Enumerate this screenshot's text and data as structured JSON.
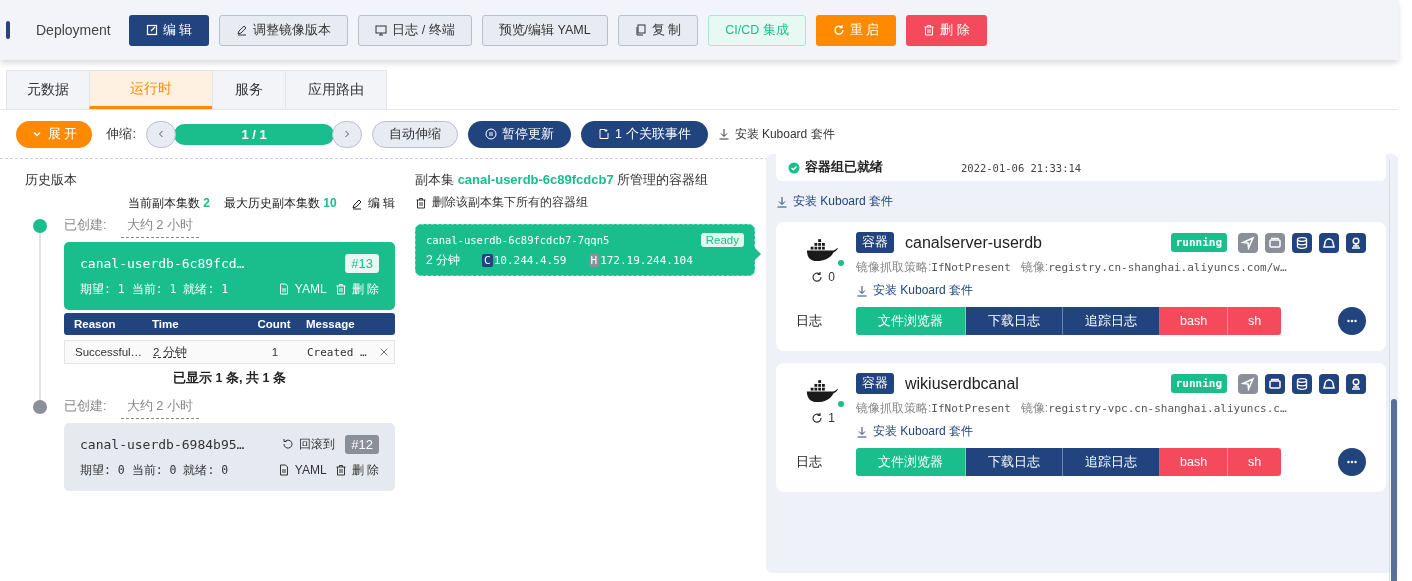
{
  "header": {
    "kind_label": "Deployment",
    "buttons": [
      {
        "label": "编 辑",
        "kind": "primary"
      },
      {
        "label": "调整镜像版本",
        "kind": "default"
      },
      {
        "label": "日志 / 终端",
        "kind": "default"
      },
      {
        "label": "预览/编辑 YAML",
        "kind": "default"
      },
      {
        "label": "复 制",
        "kind": "default"
      },
      {
        "label": "CI/CD 集成",
        "kind": "plain-success"
      },
      {
        "label": "重 启",
        "kind": "warning"
      },
      {
        "label": "删 除",
        "kind": "danger"
      }
    ]
  },
  "tabs": [
    {
      "label": "元数据",
      "selected": false
    },
    {
      "label": "运行时",
      "selected": true
    },
    {
      "label": "服务",
      "selected": false
    },
    {
      "label": "应用路由",
      "selected": false
    }
  ],
  "toolbar": {
    "expand": "展 开",
    "scale_label": "伸缩:",
    "replicas": "1 / 1",
    "level": 1,
    "auto_scale": "自动伸缩",
    "pause": "暂停更新",
    "events": "1 个关联事件",
    "install": "安装 Kuboard 套件"
  },
  "history": {
    "title": "历史版本",
    "current_label": "当前副本集数",
    "current_value": "2",
    "max_label": "最大历史副本集数",
    "max_value": "10",
    "edit": "编 辑",
    "revisions": [
      {
        "created_label": "已创建:",
        "created_time": "大约 2 小时",
        "name": "canal-userdb-6c89fcd…",
        "number": "#13",
        "current": true,
        "stats": "期望: 1 当前: 1 就绪: 1",
        "yaml": "YAML",
        "delete": "删 除",
        "events": {
          "columns": [
            "Reason",
            "Time",
            "Count",
            "Message"
          ],
          "rows": [
            [
              "Successful…",
              "2 分钟",
              "1",
              "Created …"
            ]
          ],
          "summary": "已显示 1 条, 共 1 条"
        }
      },
      {
        "created_label": "已创建:",
        "created_time": "大约 2 小时",
        "name": "canal-userdb-6984b95…",
        "number": "#12",
        "current": false,
        "rollback": "回滚到",
        "stats": "期望: 0 当前: 0 就绪: 0",
        "yaml": "YAML",
        "delete": "删 除"
      }
    ]
  },
  "replicaset": {
    "title_prefix": "副本集",
    "name": "canal-userdb-6c89fcdcb7",
    "title_suffix": "所管理的容器组",
    "delete_all": "删除该副本集下所有的容器组",
    "pods": [
      {
        "name": "canal-userdb-6c89fcdcb7-7qqn5",
        "status": "Ready",
        "age": "2 分钟",
        "container_tag": "C",
        "container_ip": "10.244.4.59",
        "host_tag": "H",
        "host_ip": "172.19.244.104"
      }
    ]
  },
  "pod_detail": {
    "ready_label": "容器组已就绪",
    "ready_time": "2022-01-06 21:33:14",
    "install": "安装 Kuboard 套件",
    "containers": [
      {
        "tag": "容器",
        "name": "canalserver-userdb",
        "status": "running",
        "pull_policy_label": "镜像抓取策略:",
        "pull_policy": "IfNotPresent",
        "image_label": "镜像:",
        "image": "registry.cn-shanghai.aliyuncs.com/w…",
        "restarts": "0",
        "install": "安装 Kuboard 套件",
        "log_label": "日志",
        "actions": [
          {
            "label": "文件浏览器",
            "kind": "success"
          },
          {
            "label": "下载日志",
            "kind": "primary"
          },
          {
            "label": "追踪日志",
            "kind": "primary"
          },
          {
            "label": "bash",
            "kind": "danger"
          },
          {
            "label": "sh",
            "kind": "danger"
          }
        ],
        "tools": [
          {
            "enabled": false
          },
          {
            "enabled": false
          },
          {
            "enabled": true
          },
          {
            "enabled": true
          },
          {
            "enabled": true
          }
        ]
      },
      {
        "tag": "容器",
        "name": "wikiuserdbcanal",
        "status": "running",
        "pull_policy_label": "镜像抓取策略:",
        "pull_policy": "IfNotPresent",
        "image_label": "镜像:",
        "image": "registry-vpc.cn-shanghai.aliyuncs.c…",
        "restarts": "1",
        "install": "安装 Kuboard 套件",
        "log_label": "日志",
        "actions": [
          {
            "label": "文件浏览器",
            "kind": "success"
          },
          {
            "label": "下载日志",
            "kind": "primary"
          },
          {
            "label": "追踪日志",
            "kind": "primary"
          },
          {
            "label": "bash",
            "kind": "danger"
          },
          {
            "label": "sh",
            "kind": "danger"
          }
        ],
        "tools": [
          {
            "enabled": false
          },
          {
            "enabled": true
          },
          {
            "enabled": true
          },
          {
            "enabled": true
          },
          {
            "enabled": true
          }
        ]
      }
    ]
  }
}
